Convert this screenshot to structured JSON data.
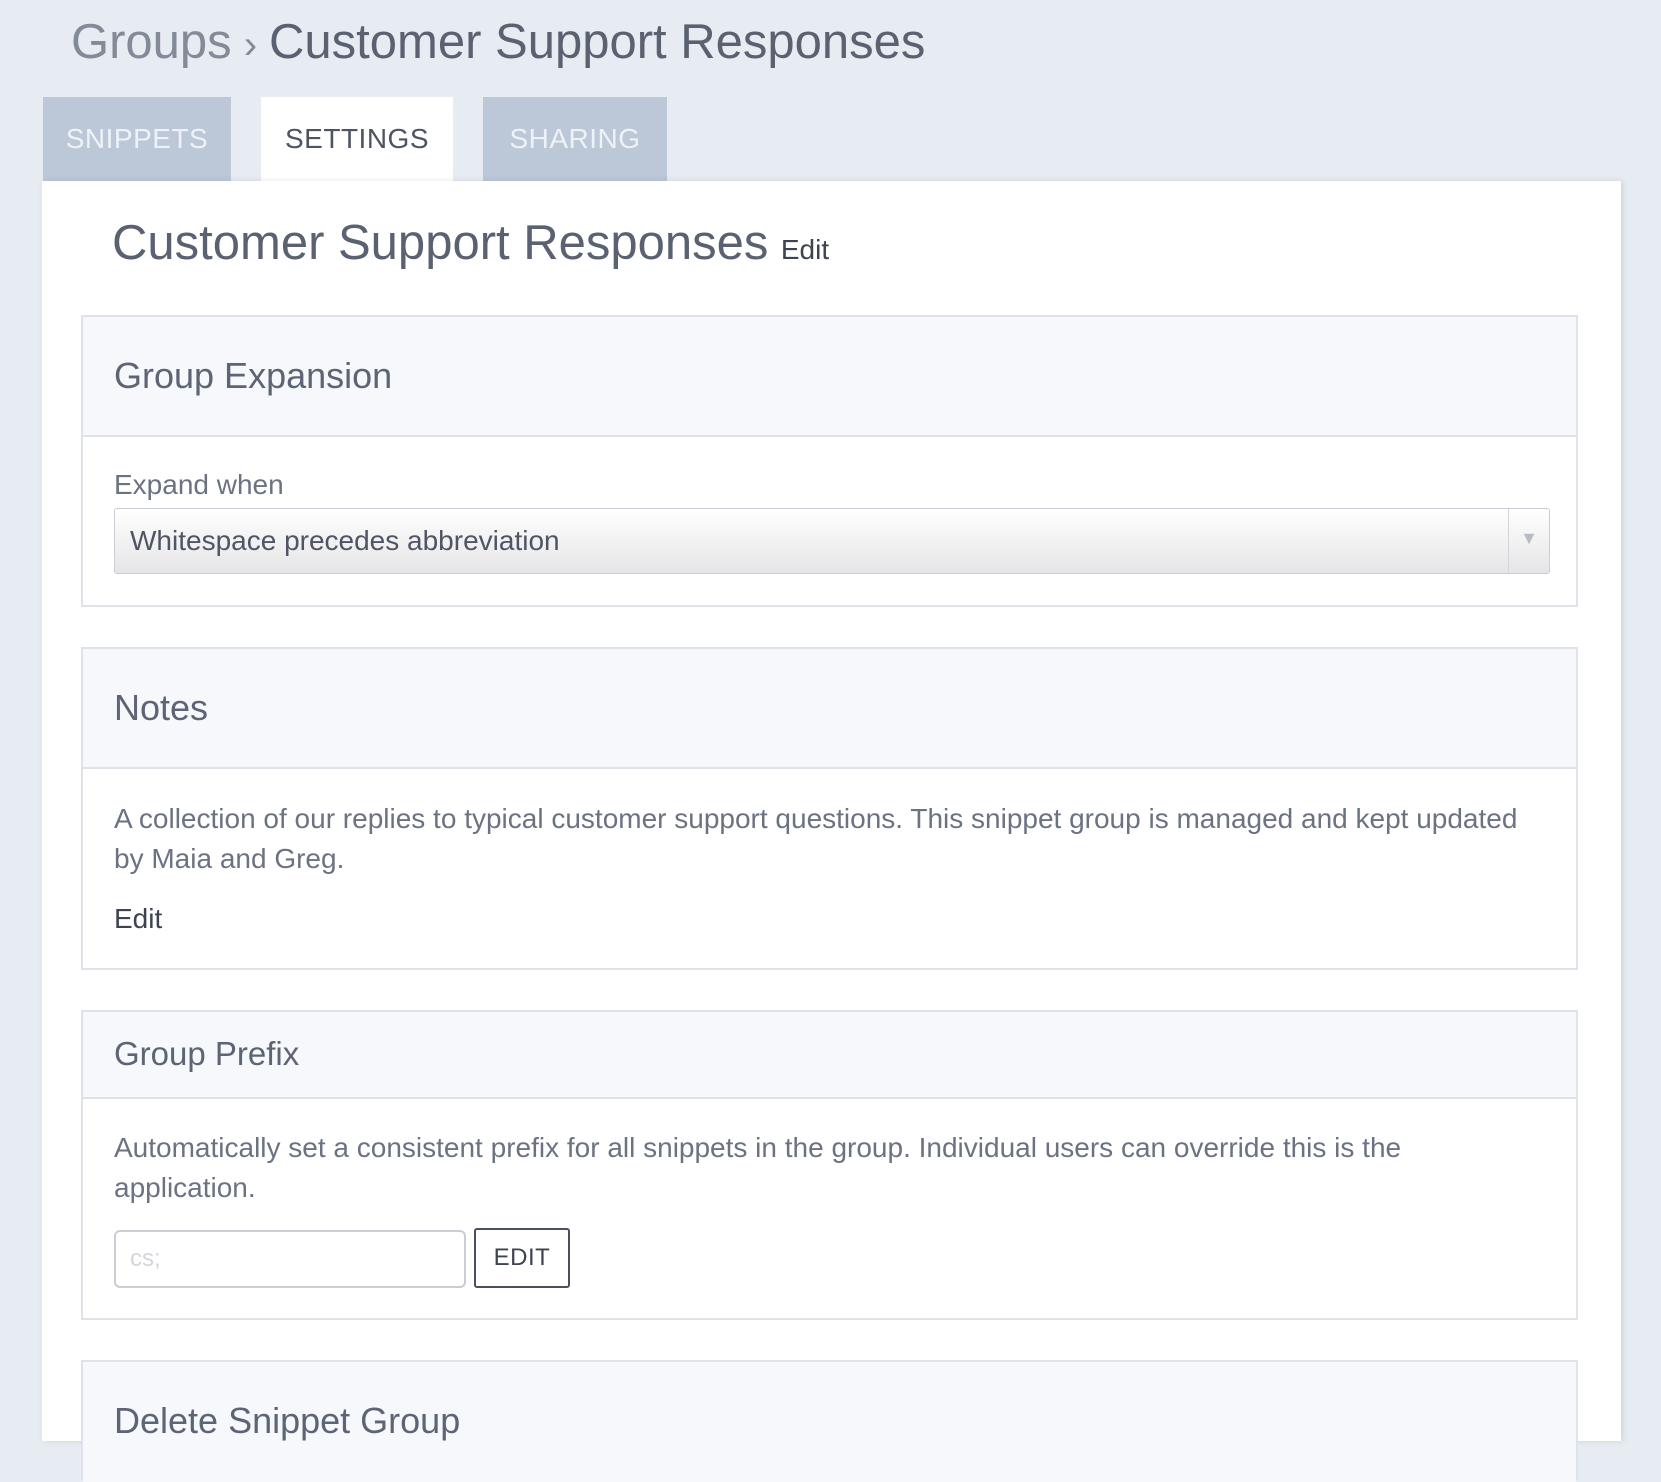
{
  "breadcrumb": {
    "root": "Groups",
    "separator": "›",
    "current": "Customer Support Responses"
  },
  "tabs": [
    {
      "label": "SNIPPETS",
      "active": false
    },
    {
      "label": "SETTINGS",
      "active": true
    },
    {
      "label": "SHARING",
      "active": false
    }
  ],
  "group": {
    "title": "Customer Support Responses",
    "edit_label": "Edit"
  },
  "expansion": {
    "title": "Group Expansion",
    "field_label": "Expand when",
    "selected": "Whitespace precedes abbreviation",
    "arrow_icon": "▼"
  },
  "notes": {
    "title": "Notes",
    "text": "A collection of our replies to typical customer support questions. This snippet group is managed and kept updated by Maia and Greg.",
    "edit_label": "Edit"
  },
  "prefix": {
    "title": "Group Prefix",
    "description": "Automatically set a consistent prefix for all snippets in the group. Individual users can override this is the application.",
    "placeholder": "cs;",
    "button_label": "EDIT"
  },
  "delete_section": {
    "title": "Delete Snippet Group"
  },
  "colors": {
    "page_background": "#e7ebf2",
    "inactive_tab": "#bcc8d8",
    "panel": "#ffffff",
    "card_header": "#f6f8fb"
  }
}
